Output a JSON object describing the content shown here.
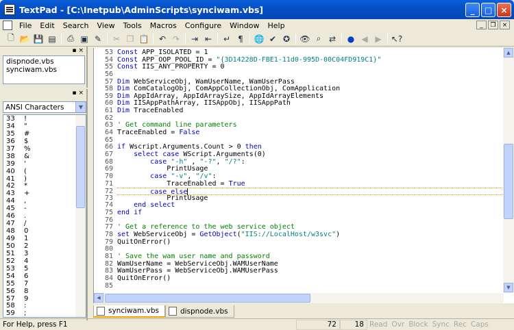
{
  "window": {
    "title": "TextPad - [C:\\Inetpub\\AdminScripts\\synciwam.vbs]",
    "buttons": {
      "minimize": "_",
      "maximize": "□",
      "close": "×"
    }
  },
  "menu": {
    "items": [
      "File",
      "Edit",
      "Search",
      "View",
      "Tools",
      "Macros",
      "Configure",
      "Window",
      "Help"
    ],
    "mdi": {
      "minimize": "_",
      "restore": "❐",
      "close": "×"
    }
  },
  "toolbar": {
    "icons": [
      "new-file",
      "open-file",
      "save",
      "save-all",
      "print",
      "print-preview",
      "spelling",
      "cut",
      "copy",
      "paste",
      "undo",
      "redo",
      "indent",
      "outdent",
      "word-wrap",
      "paragraph",
      "web",
      "spell-check",
      "find",
      "find-next",
      "replace",
      "bookmark",
      "prev",
      "next",
      "help"
    ]
  },
  "document_selector": {
    "items": [
      "dispnode.vbs",
      "synciwam.vbs"
    ]
  },
  "clip_library": {
    "selected": "ANSI Characters",
    "rows": [
      {
        "n": "33",
        "c": "!"
      },
      {
        "n": "34",
        "c": "\""
      },
      {
        "n": "35",
        "c": "#"
      },
      {
        "n": "36",
        "c": "$"
      },
      {
        "n": "37",
        "c": "%"
      },
      {
        "n": "38",
        "c": "&"
      },
      {
        "n": "39",
        "c": "'"
      },
      {
        "n": "40",
        "c": "("
      },
      {
        "n": "41",
        "c": ")"
      },
      {
        "n": "42",
        "c": "*"
      },
      {
        "n": "43",
        "c": "+"
      },
      {
        "n": "44",
        "c": ","
      },
      {
        "n": "45",
        "c": "-"
      },
      {
        "n": "46",
        "c": "."
      },
      {
        "n": "47",
        "c": "/"
      },
      {
        "n": "48",
        "c": "0"
      },
      {
        "n": "49",
        "c": "1"
      },
      {
        "n": "50",
        "c": "2"
      },
      {
        "n": "51",
        "c": "3"
      },
      {
        "n": "52",
        "c": "4"
      },
      {
        "n": "53",
        "c": "5"
      },
      {
        "n": "54",
        "c": "6"
      },
      {
        "n": "55",
        "c": "7"
      },
      {
        "n": "56",
        "c": "8"
      },
      {
        "n": "57",
        "c": "9"
      },
      {
        "n": "58",
        "c": ":"
      },
      {
        "n": "59",
        "c": ";"
      }
    ]
  },
  "editor": {
    "lines": [
      {
        "n": "53",
        "parts": [
          [
            "kw",
            "Const"
          ],
          [
            "",
            "APP_ISOLATED = 1"
          ]
        ]
      },
      {
        "n": "54",
        "parts": [
          [
            "kw",
            "Const"
          ],
          [
            "",
            "APP_OOP_POOL_ID = "
          ],
          [
            "str",
            "\"{3D14228D-FBE1-11d0-995D-00C04FD919C1}\""
          ]
        ]
      },
      {
        "n": "55",
        "parts": [
          [
            "kw",
            "Const"
          ],
          [
            "",
            "IIS_ANY_PROPERTY = 0"
          ]
        ]
      },
      {
        "n": "56",
        "parts": []
      },
      {
        "n": "57",
        "parts": [
          [
            "kw",
            "Dim"
          ],
          [
            "",
            "WebServiceObj, WamUserName, WamUserPass"
          ]
        ]
      },
      {
        "n": "58",
        "parts": [
          [
            "kw",
            "Dim"
          ],
          [
            "",
            "ComCatalogObj, ComAppCollectionObj, ComApplication"
          ]
        ]
      },
      {
        "n": "59",
        "parts": [
          [
            "kw",
            "Dim"
          ],
          [
            "",
            "AppIdArray, AppIdArraySize, AppIdArrayElements"
          ]
        ]
      },
      {
        "n": "60",
        "parts": [
          [
            "kw",
            "Dim"
          ],
          [
            "",
            "IISAppPathArray, IISAppObj, IISAppPath"
          ]
        ]
      },
      {
        "n": "61",
        "parts": [
          [
            "kw",
            "Dim"
          ],
          [
            "",
            "TraceEnabled"
          ]
        ]
      },
      {
        "n": "62",
        "parts": []
      },
      {
        "n": "63",
        "parts": [
          [
            "cmt",
            "' Get command line parameters"
          ]
        ]
      },
      {
        "n": "64",
        "parts": [
          [
            "",
            "TraceEnabled = "
          ],
          [
            "kw",
            "False"
          ]
        ]
      },
      {
        "n": "65",
        "parts": []
      },
      {
        "n": "66",
        "parts": [
          [
            "kw",
            "if"
          ],
          [
            "",
            "Wscript.Arguments.Count > 0 "
          ],
          [
            "kw",
            "then"
          ]
        ]
      },
      {
        "n": "67",
        "parts": [
          [
            "",
            "    "
          ],
          [
            "kw",
            "select case"
          ],
          [
            "",
            "WScript.Arguments(0)"
          ]
        ]
      },
      {
        "n": "68",
        "parts": [
          [
            "",
            "        "
          ],
          [
            "kw",
            "case"
          ],
          [
            "str",
            "\"-h\""
          ],
          [
            "",
            " , "
          ],
          [
            "str",
            "\"-?\""
          ],
          [
            "",
            ", "
          ],
          [
            "str",
            "\"/?\""
          ],
          [
            "",
            ":"
          ]
        ]
      },
      {
        "n": "69",
        "parts": [
          [
            "",
            "            PrintUsage"
          ]
        ]
      },
      {
        "n": "70",
        "parts": [
          [
            "",
            "        "
          ],
          [
            "kw",
            "case"
          ],
          [
            "str",
            "\"-v\""
          ],
          [
            "",
            ", "
          ],
          [
            "str",
            "\"/v\""
          ],
          [
            "",
            ":"
          ]
        ]
      },
      {
        "n": "71",
        "parts": [
          [
            "",
            "            TraceEnabled = "
          ],
          [
            "kw",
            "True"
          ]
        ]
      },
      {
        "n": "72",
        "parts": [
          [
            "",
            "        "
          ],
          [
            "kw",
            "case else"
          ]
        ],
        "current": true
      },
      {
        "n": "73",
        "parts": [
          [
            "",
            "            PrintUsage"
          ]
        ]
      },
      {
        "n": "74",
        "parts": [
          [
            "",
            "    "
          ],
          [
            "kw",
            "end select"
          ]
        ]
      },
      {
        "n": "75",
        "parts": [
          [
            "kw",
            "end if"
          ]
        ]
      },
      {
        "n": "76",
        "parts": []
      },
      {
        "n": "77",
        "parts": [
          [
            "cmt",
            "' Get a reference to the web service object"
          ]
        ]
      },
      {
        "n": "78",
        "parts": [
          [
            "kw",
            "set"
          ],
          [
            "",
            "WebServiceObj = "
          ],
          [
            "kw",
            "GetObject"
          ],
          [
            "",
            "("
          ],
          [
            "str",
            "\"IIS://LocalHost/w3svc\""
          ],
          [
            "",
            ")"
          ]
        ]
      },
      {
        "n": "79",
        "parts": [
          [
            "",
            "QuitOnError()"
          ]
        ]
      },
      {
        "n": "80",
        "parts": []
      },
      {
        "n": "81",
        "parts": [
          [
            "cmt",
            "' Save the wam user name and password"
          ]
        ]
      },
      {
        "n": "82",
        "parts": [
          [
            "",
            "WamUserName = WebServiceObj.WAMUserName"
          ]
        ]
      },
      {
        "n": "83",
        "parts": [
          [
            "",
            "WamUserPass = WebServiceObj.WAMUserPass"
          ]
        ]
      },
      {
        "n": "84",
        "parts": [
          [
            "",
            "QuitOnError()"
          ]
        ]
      },
      {
        "n": "85",
        "parts": []
      }
    ]
  },
  "tabs": [
    {
      "label": "synciwam.vbs",
      "active": true
    },
    {
      "label": "dispnode.vbs",
      "active": false
    }
  ],
  "status": {
    "help": "For Help, press F1",
    "line": "72",
    "column": "18",
    "indicators": [
      "Read",
      "Ovr",
      "Block",
      "Sync",
      "Rec",
      "Caps"
    ]
  }
}
